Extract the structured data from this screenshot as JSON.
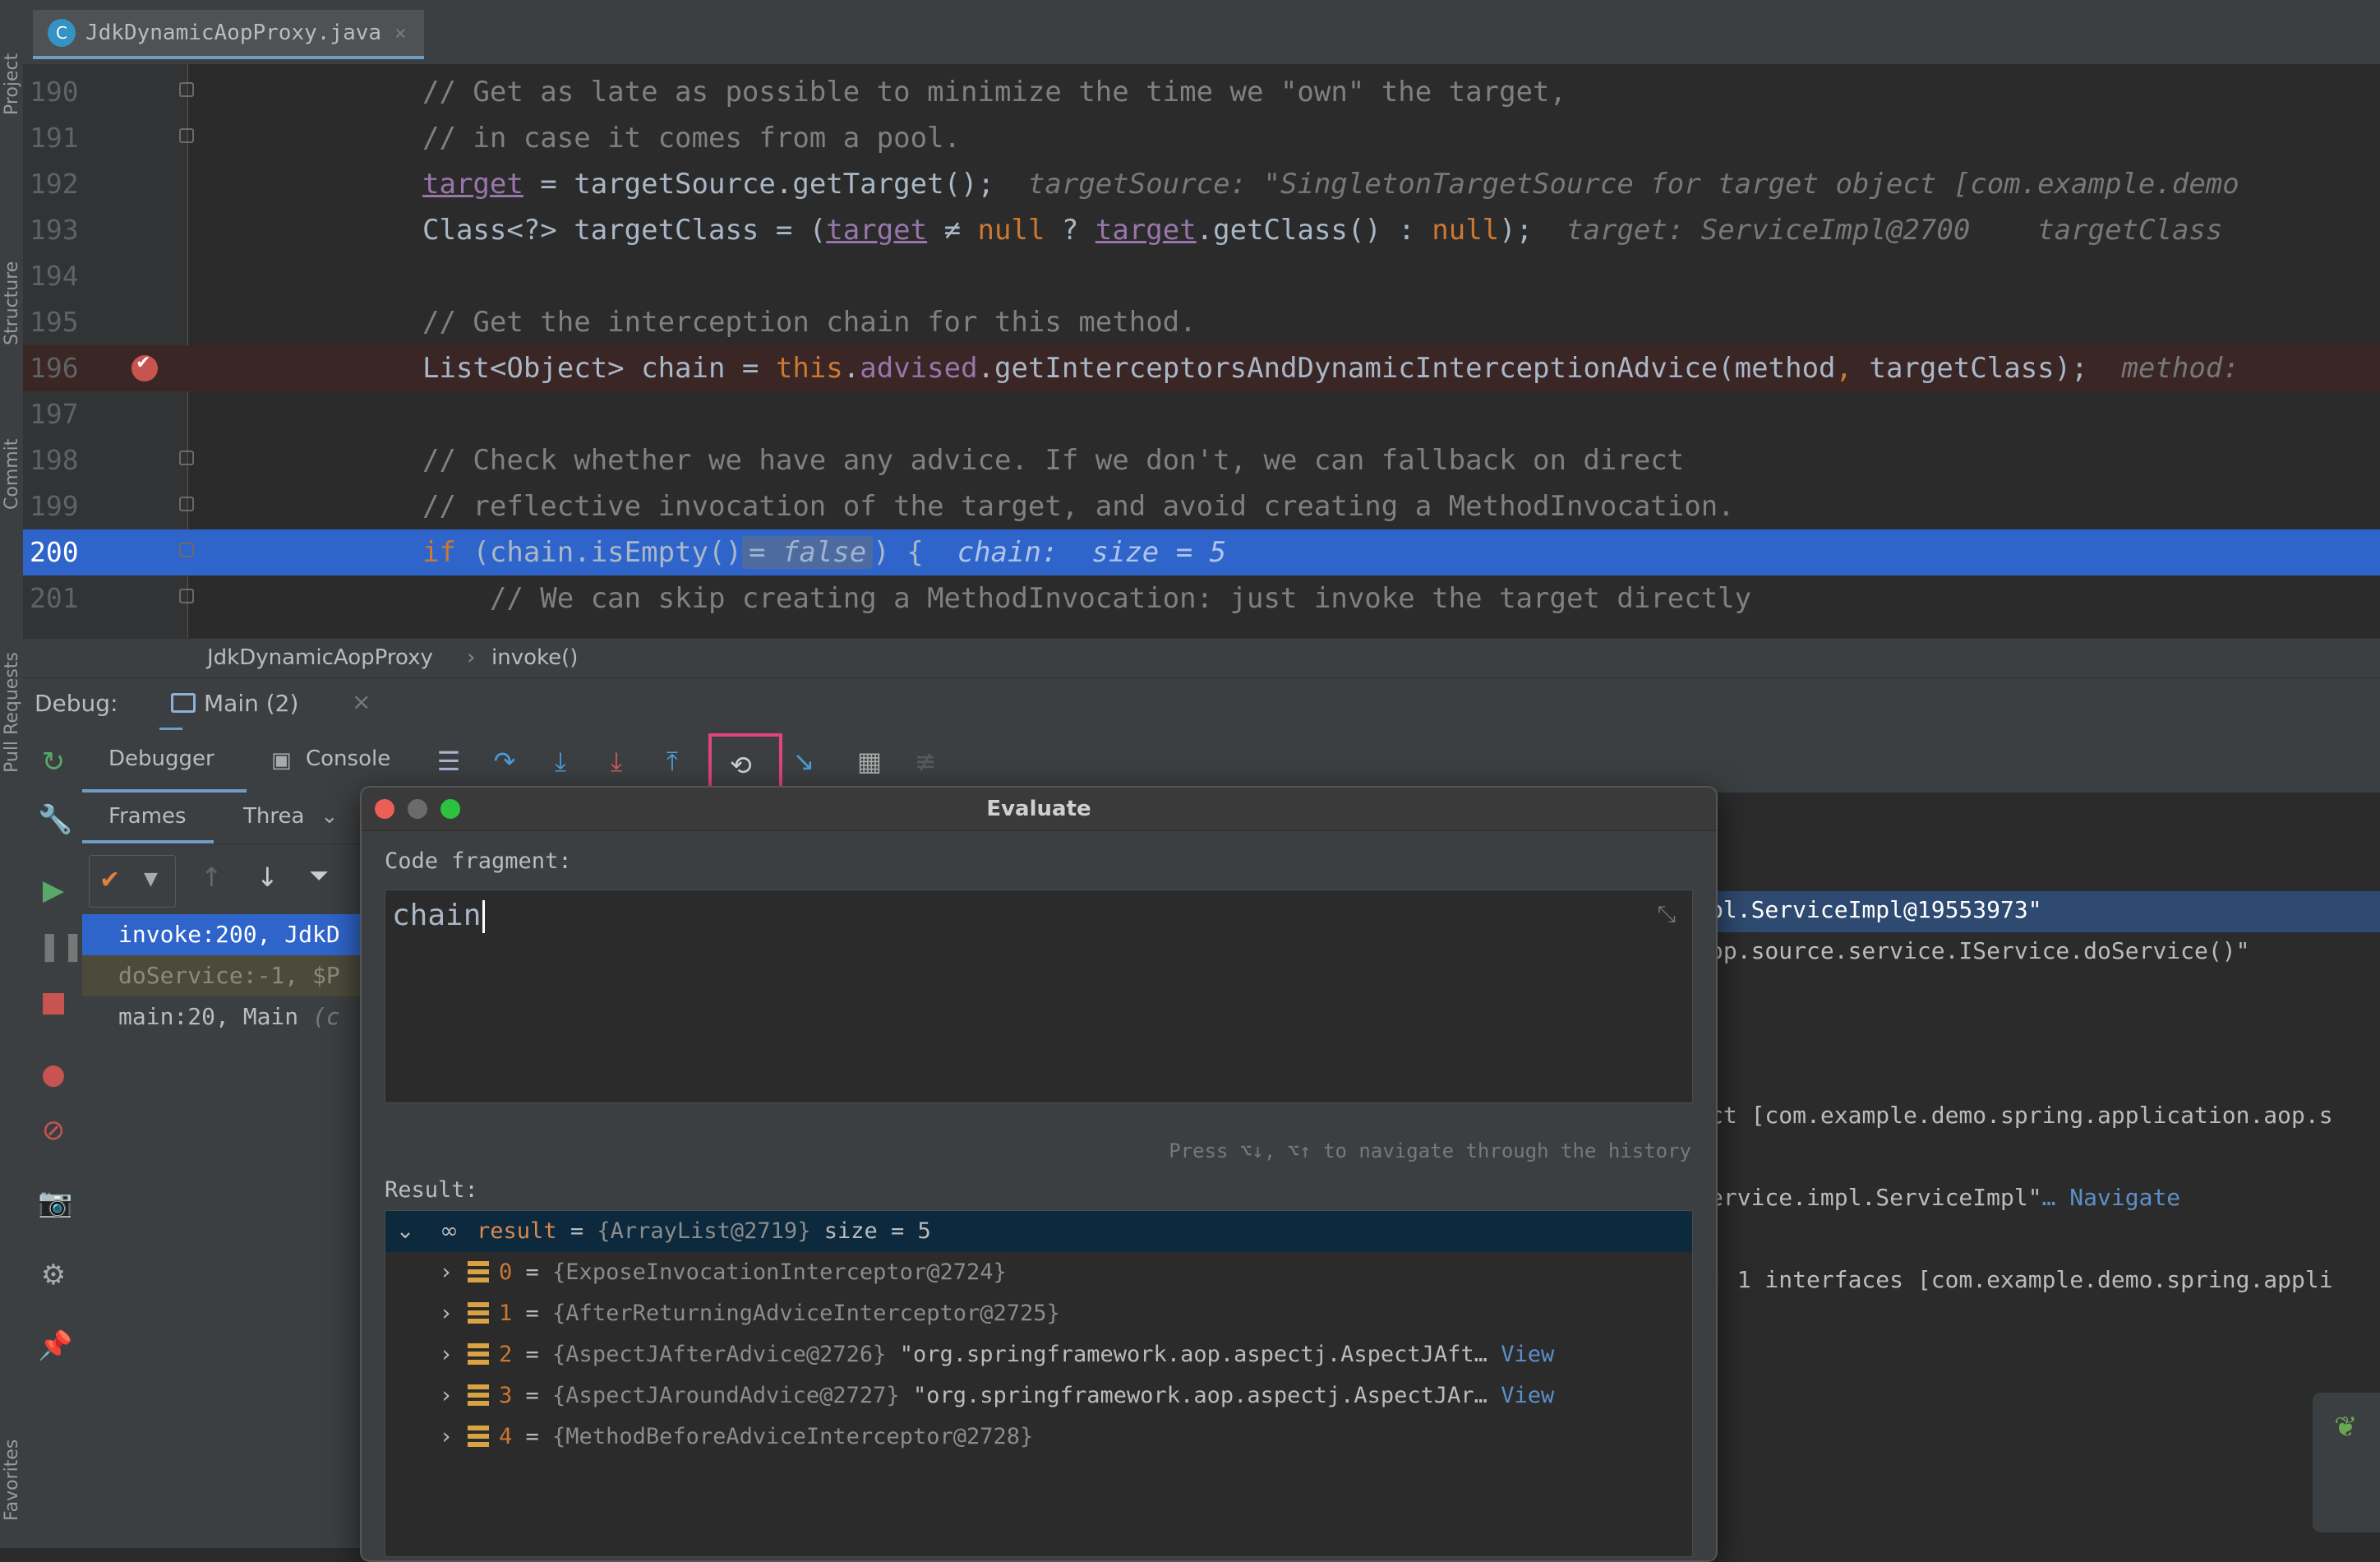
{
  "tool_window_tabs": [
    "Project",
    "Structure",
    "Commit",
    "Pull Requests",
    "Favorites"
  ],
  "editor": {
    "tab_label": "JdkDynamicAopProxy.java",
    "lines": [
      {
        "n": "190",
        "code": "// Get as late as possible to minimize the time we \"own\" the target,"
      },
      {
        "n": "191",
        "code": "// in case it comes from a pool."
      },
      {
        "n": "192",
        "code_a": "target",
        "code_b": " = targetSource.getTarget();",
        "hint": "  targetSource: \"SingletonTargetSource for target object [com.example.demo"
      },
      {
        "n": "193",
        "code_a": "Class<?> targetClass = (",
        "code_b": "target",
        "code_c": " ≠ ",
        "code_d": "null",
        "code_e": " ? ",
        "code_f": "target",
        "code_g": ".getClass() : ",
        "code_h": "null",
        "code_i": ");",
        "hint": "  target: ServiceImpl@2700    targetClass"
      },
      {
        "n": "194",
        "code": ""
      },
      {
        "n": "195",
        "code": "// Get the interception chain for this method."
      },
      {
        "n": "196",
        "code_a": "List<Object> chain = ",
        "code_b": "this",
        "code_c": ".",
        "code_d": "advised",
        "code_e": ".getInterceptorsAndDynamicInterceptionAdvice(method",
        "code_f": ", ",
        "code_g": "targetClass);",
        "hint": "  method:"
      },
      {
        "n": "197",
        "code": ""
      },
      {
        "n": "198",
        "code": "// Check whether we have any advice. If we don't, we can fallback on direct"
      },
      {
        "n": "199",
        "code": "// reflective invocation of the target, and avoid creating a MethodInvocation."
      },
      {
        "n": "200",
        "code_a": "if",
        "code_b": " (chain.isEmpty()",
        "inline": "= false",
        "code_c": ") {",
        "hint": "  chain:  size = 5"
      },
      {
        "n": "201",
        "code": "    // We can skip creating a MethodInvocation: just invoke the target directly"
      }
    ]
  },
  "breadcrumbs": [
    "JdkDynamicAopProxy",
    "invoke()"
  ],
  "debug": {
    "label": "Debug:",
    "session": "Main (2)",
    "tabs": {
      "debugger": "Debugger",
      "console": "Console"
    },
    "subtabs": {
      "frames": "Frames",
      "threads": "Threa"
    },
    "frames": [
      {
        "text": "invoke:200, JdkD",
        "state": "selected"
      },
      {
        "text": "doService:-1, $P",
        "state": "dim"
      },
      {
        "text": "main:20, Main",
        "suffix": " (c",
        "state": "normal"
      }
    ],
    "variables": [
      {
        "text": "pl.ServiceImpl@19553973\""
      },
      {
        "text": "op.source.service.IService.doService()\""
      },
      {
        "text": "ct [com.example.demo.spring.application.aop.s"
      },
      {
        "text": "ervice.impl.ServiceImpl\"",
        "link": "… Navigate"
      },
      {
        "text": ": 1 interfaces [com.example.demo.spring.appli"
      }
    ]
  },
  "evaluate": {
    "title": "Evaluate",
    "code_label": "Code fragment:",
    "code_value": "chain",
    "history_hint": "Press ⌥↓, ⌥↑ to navigate through the history",
    "result_label": "Result:",
    "result": {
      "name": "result",
      "ref": "{ArrayList@2719}",
      "size": "size = 5",
      "items": [
        {
          "idx": "0",
          "ref": "{ExposeInvocationInterceptor@2724}",
          "str": "",
          "link": ""
        },
        {
          "idx": "1",
          "ref": "{AfterReturningAdviceInterceptor@2725}",
          "str": "",
          "link": ""
        },
        {
          "idx": "2",
          "ref": "{AspectJAfterAdvice@2726}",
          "str": "\"org.springframework.aop.aspectj.AspectJAft…",
          "link": "View"
        },
        {
          "idx": "3",
          "ref": "{AspectJAroundAdvice@2727}",
          "str": "\"org.springframework.aop.aspectj.AspectJAr…",
          "link": "View"
        },
        {
          "idx": "4",
          "ref": "{MethodBeforeAdviceInterceptor@2728}",
          "str": "",
          "link": ""
        }
      ]
    }
  },
  "colors": {
    "accent_selection": "#2f65ca",
    "breakpoint": "#c75450",
    "highlight_box": "#e0447a",
    "keyword": "#cc7832",
    "field": "#9876aa"
  }
}
